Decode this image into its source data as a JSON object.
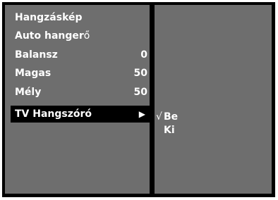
{
  "menu": {
    "items": [
      {
        "label_a": "Hangzáskép",
        "label_b": "",
        "value": ""
      },
      {
        "label_a": "Auto hanger",
        "label_b": "ő",
        "value": ""
      },
      {
        "label_a": "Balansz",
        "label_b": "",
        "value": "0"
      },
      {
        "label_a": "Magas",
        "label_b": "",
        "value": "50"
      },
      {
        "label_a": "Mély",
        "label_b": "",
        "value": "50"
      }
    ],
    "selected": {
      "label": "TV Hangszóró",
      "arrow": "▶"
    }
  },
  "submenu": {
    "check": "√",
    "options": [
      "Be",
      "Ki"
    ],
    "selected_index": 0
  }
}
